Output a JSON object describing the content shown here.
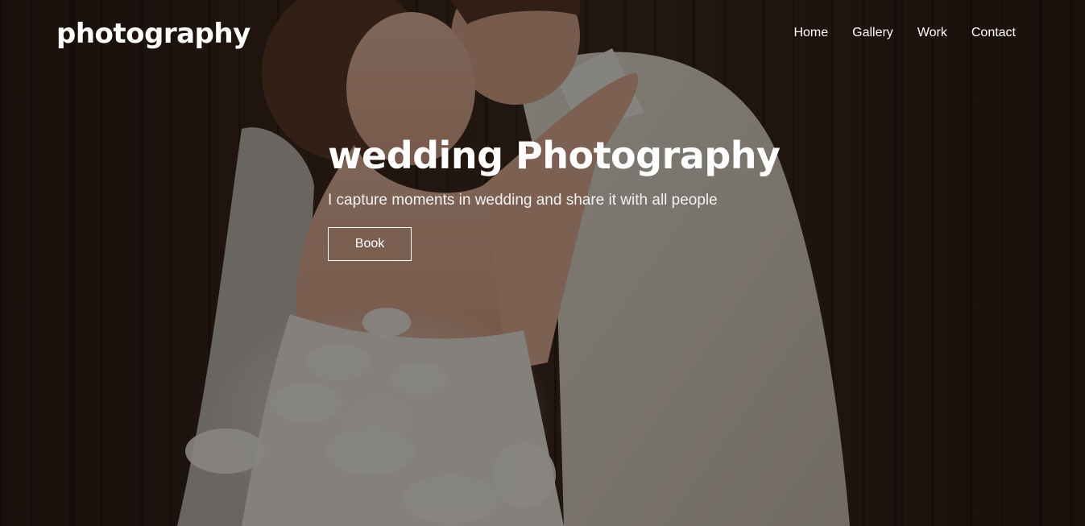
{
  "header": {
    "logo": "photography",
    "nav": [
      {
        "label": "Home"
      },
      {
        "label": "Gallery"
      },
      {
        "label": "Work"
      },
      {
        "label": "Contact"
      }
    ]
  },
  "hero": {
    "title": "wedding Photography",
    "subtitle": "I capture moments in wedding and share it with all people",
    "button_label": "Book",
    "background_image": "wedding couple embracing with bouquet, wooden backdrop"
  },
  "colors": {
    "text": "#ffffff",
    "overlay": "#000000",
    "background_wood": "#3a2519"
  }
}
